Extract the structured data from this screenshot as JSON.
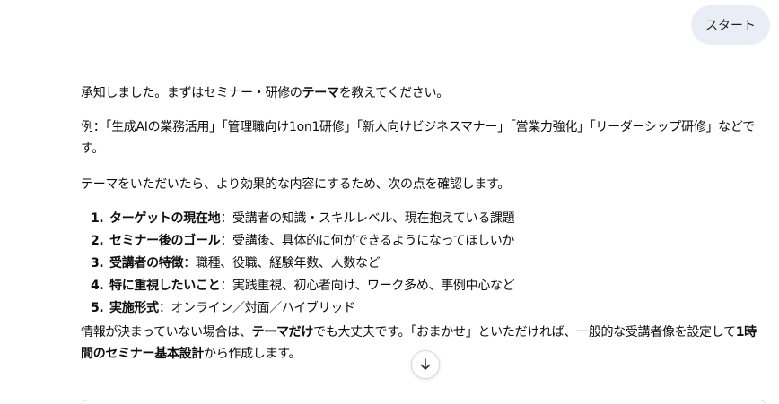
{
  "user_message": "スタート",
  "assistant": {
    "intro_pre": "承知しました。まずはセミナー・研修の",
    "intro_bold": "テーマ",
    "intro_post": "を教えてください。",
    "example": "例：「生成AIの業務活用」「管理職向け1on1研修」「新人向けビジネスマナー」「営業力強化」「リーダーシップ研修」などです。",
    "lead": "テーマをいただいたら、より効果的な内容にするため、次の点を確認します。",
    "points": [
      {
        "num": "1.",
        "title": "ターゲットの現在地",
        "sep": "：",
        "desc": "受講者の知識・スキルレベル、現在抱えている課題"
      },
      {
        "num": "2.",
        "title": "セミナー後のゴール",
        "sep": "：",
        "desc": "受講後、具体的に何ができるようになってほしいか"
      },
      {
        "num": "3.",
        "title": "受講者の特徴",
        "sep": "：",
        "desc": "職種、役職、経験年数、人数など"
      },
      {
        "num": "4.",
        "title": "特に重視したいこと",
        "sep": "：",
        "desc": "実践重視、初心者向け、ワーク多め、事例中心など"
      },
      {
        "num": "5.",
        "title": "実施形式",
        "sep": "：",
        "desc": "オンライン／対面／ハイブリッド"
      }
    ],
    "closing_1": "情報が決まっていない場合は、",
    "closing_2": "テーマだけ",
    "closing_3": "でも大丈夫です。「おまかせ」といただければ、一般的な受講者像を設定して",
    "closing_4": "1時間のセミナー基本設計",
    "closing_5": "から作成します。"
  },
  "scroll_button": {
    "icon": "arrow-down-icon"
  }
}
